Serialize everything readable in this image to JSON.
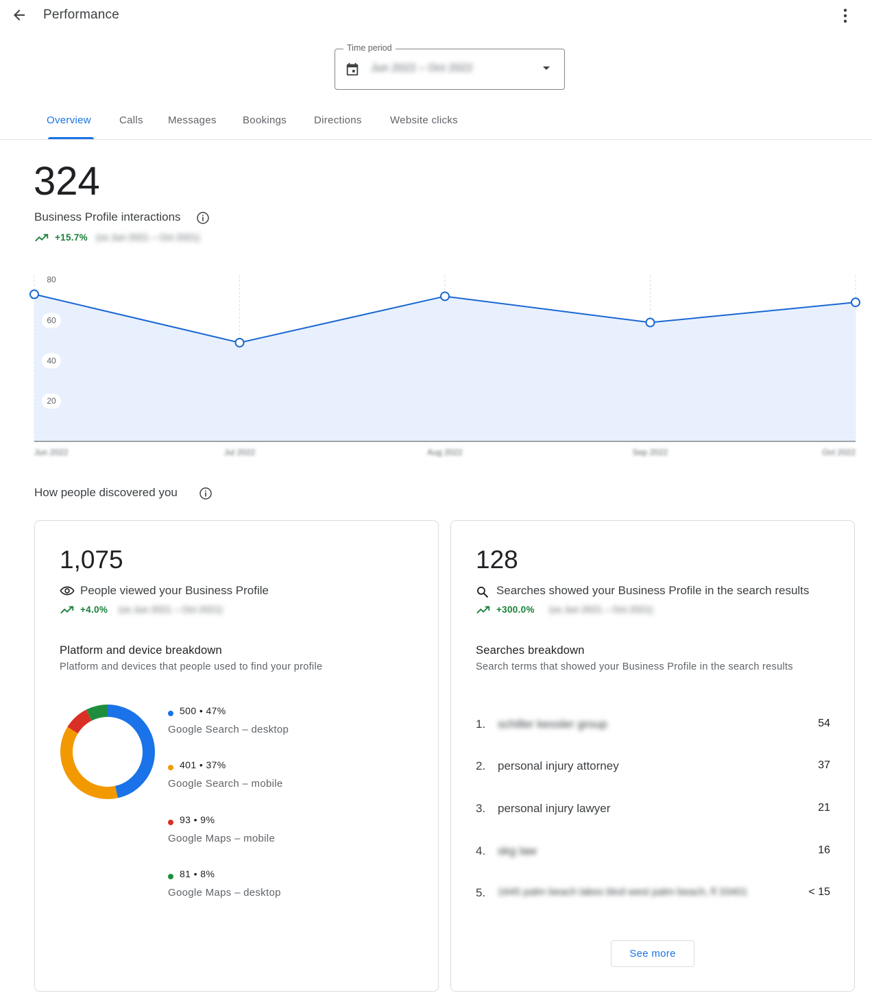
{
  "header": {
    "title": "Performance",
    "back_icon": "arrow-back-icon",
    "more_icon": "more-vert-icon"
  },
  "time_period": {
    "label": "Time period",
    "value": "Jun 2022 – Oct 2022",
    "icon": "calendar-icon"
  },
  "tabs": [
    {
      "label": "Overview",
      "active": true
    },
    {
      "label": "Calls"
    },
    {
      "label": "Messages"
    },
    {
      "label": "Bookings"
    },
    {
      "label": "Directions"
    },
    {
      "label": "Website clicks"
    }
  ],
  "summary": {
    "value": "324",
    "label": "Business Profile interactions",
    "change": "+15.7%",
    "comparison": "(vs Jun 2021 – Oct 2021)"
  },
  "chart_data": {
    "type": "area",
    "x": [
      "Jun 2022",
      "Jul 2022",
      "Aug 2022",
      "Sep 2022",
      "Oct 2022"
    ],
    "y": [
      73,
      49,
      72,
      59,
      69
    ],
    "yticks": [
      20,
      40,
      60,
      80
    ],
    "ylim": [
      0,
      83
    ],
    "grid": "vertical dashed",
    "color": "#1967d2",
    "fill": "#e8f0fe"
  },
  "discovered": {
    "title": "How people discovered you",
    "views": {
      "value": "1,075",
      "label": "People viewed your Business Profile",
      "change": "+4.0%",
      "comparison": "(vs Jun 2021 – Oct 2021)",
      "breakdown_title": "Platform and device breakdown",
      "breakdown_desc": "Platform and devices that people used to find your profile",
      "items": [
        {
          "value": "500 • 47%",
          "name": "Google Search – desktop",
          "count": 500,
          "color": "#1a73e8"
        },
        {
          "value": "401 • 37%",
          "name": "Google Search – mobile",
          "count": 401,
          "color": "#f29900"
        },
        {
          "value": "93 • 9%",
          "name": "Google Maps – mobile",
          "count": 93,
          "color": "#d93025"
        },
        {
          "value": "81 • 8%",
          "name": "Google Maps – desktop",
          "count": 81,
          "color": "#1e8e3e"
        }
      ]
    },
    "searches": {
      "value": "128",
      "label": "Searches showed your Business Profile in the search results",
      "change": "+300.0%",
      "comparison": "(vs Jun 2021 – Oct 2021)",
      "breakdown_title": "Searches breakdown",
      "breakdown_desc": "Search terms that showed your Business Profile in the search results",
      "items": [
        {
          "rank": "1.",
          "term": "schiller kessler group",
          "count": "54",
          "blurred": true
        },
        {
          "rank": "2.",
          "term": "personal injury attorney",
          "count": "37"
        },
        {
          "rank": "3.",
          "term": "personal injury lawyer",
          "count": "21"
        },
        {
          "rank": "4.",
          "term": "skg law",
          "count": "16",
          "blurred": true
        },
        {
          "rank": "5.",
          "term": "1645 palm beach lakes blvd west palm beach, fl 33401",
          "count": "< 15",
          "blurred": true
        }
      ],
      "see_more": "See more"
    }
  }
}
